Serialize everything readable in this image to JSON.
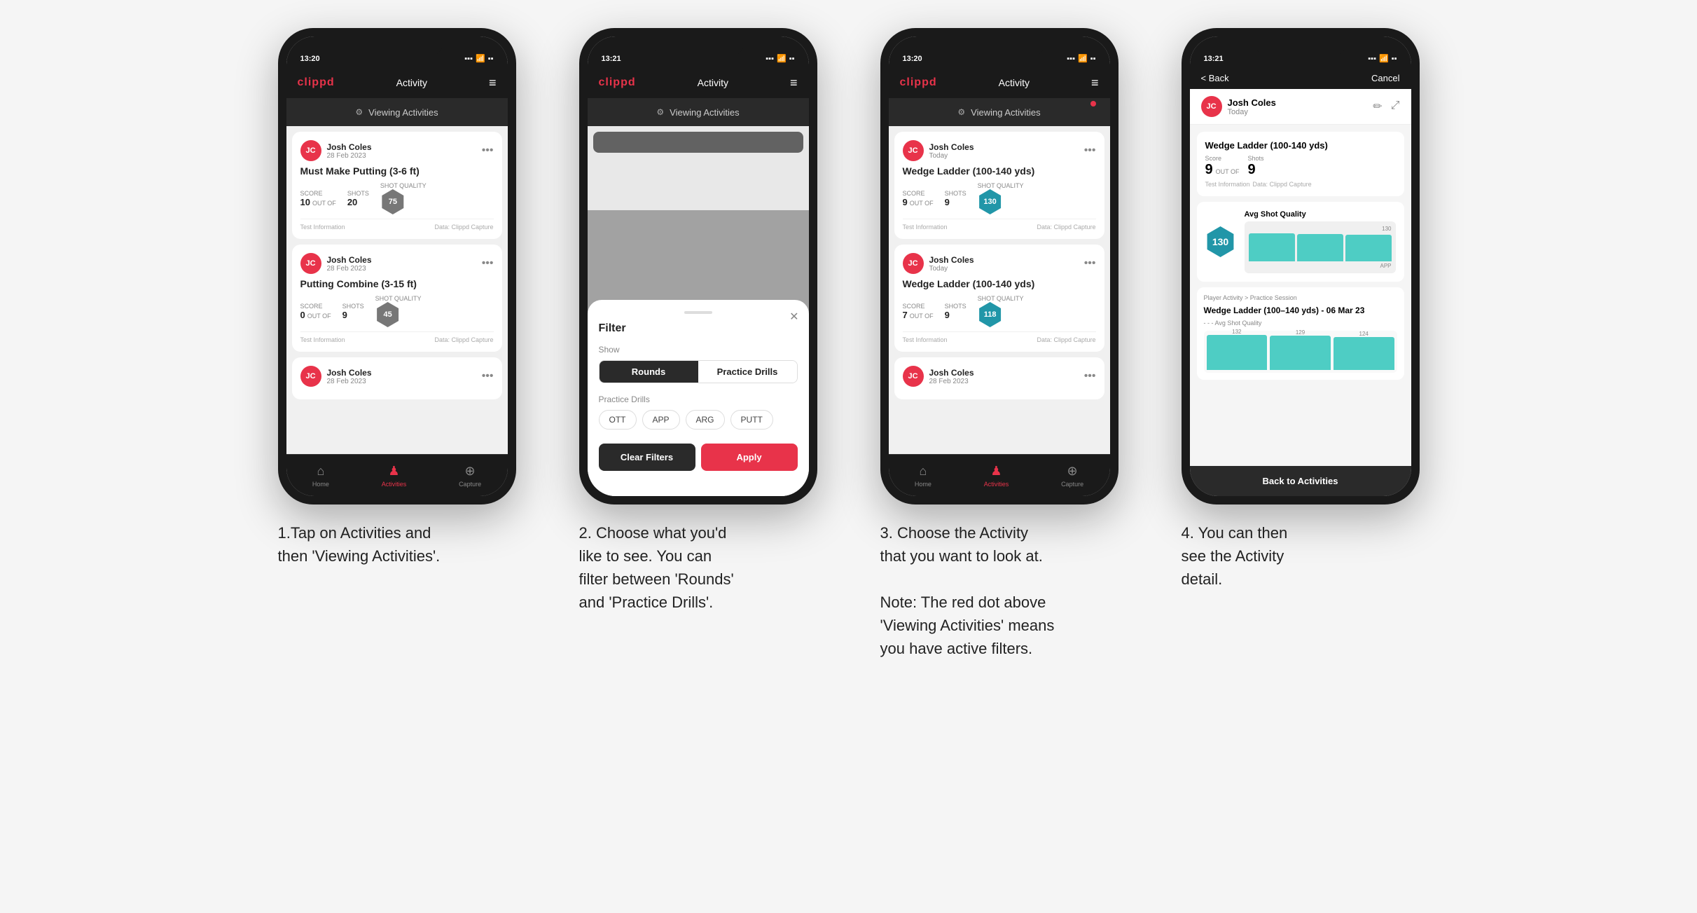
{
  "screens": [
    {
      "id": "screen1",
      "status_time": "13:20",
      "nav_title": "Activity",
      "viewing_activities": "Viewing Activities",
      "has_red_dot": false,
      "cards": [
        {
          "user_name": "Josh Coles",
          "user_date": "28 Feb 2023",
          "title": "Must Make Putting (3-6 ft)",
          "score_label": "Score",
          "shots_label": "Shots",
          "sq_label": "Shot Quality",
          "score": "10",
          "outof": "OUT OF",
          "shots": "20",
          "sq_value": "75",
          "info_left": "Test Information",
          "info_right": "Data: Clippd Capture"
        },
        {
          "user_name": "Josh Coles",
          "user_date": "28 Feb 2023",
          "title": "Putting Combine (3-15 ft)",
          "score_label": "Score",
          "shots_label": "Shots",
          "sq_label": "Shot Quality",
          "score": "0",
          "outof": "OUT OF",
          "shots": "9",
          "sq_value": "45",
          "info_left": "Test Information",
          "info_right": "Data: Clippd Capture"
        },
        {
          "user_name": "Josh Coles",
          "user_date": "28 Feb 2023",
          "title": "",
          "score": "",
          "shots": "",
          "sq_value": ""
        }
      ],
      "bottom_nav": [
        "Home",
        "Activities",
        "Capture"
      ]
    },
    {
      "id": "screen2",
      "status_time": "13:21",
      "nav_title": "Activity",
      "viewing_activities": "Viewing Activities",
      "has_red_dot": false,
      "filter": {
        "title": "Filter",
        "show_label": "Show",
        "rounds_label": "Rounds",
        "practice_drills_label": "Practice Drills",
        "practice_drills_section": "Practice Drills",
        "chips": [
          "OTT",
          "APP",
          "ARG",
          "PUTT"
        ],
        "clear_label": "Clear Filters",
        "apply_label": "Apply"
      }
    },
    {
      "id": "screen3",
      "status_time": "13:20",
      "nav_title": "Activity",
      "viewing_activities": "Viewing Activities",
      "has_red_dot": true,
      "cards": [
        {
          "user_name": "Josh Coles",
          "user_date": "Today",
          "title": "Wedge Ladder (100-140 yds)",
          "score": "9",
          "outof": "OUT OF",
          "shots": "9",
          "sq_value": "130",
          "info_left": "Test Information",
          "info_right": "Data: Clippd Capture"
        },
        {
          "user_name": "Josh Coles",
          "user_date": "Today",
          "title": "Wedge Ladder (100-140 yds)",
          "score": "7",
          "outof": "OUT OF",
          "shots": "9",
          "sq_value": "118",
          "info_left": "Test Information",
          "info_right": "Data: Clippd Capture"
        },
        {
          "user_name": "Josh Coles",
          "user_date": "28 Feb 2023",
          "title": "",
          "score": "",
          "shots": "",
          "sq_value": ""
        }
      ],
      "bottom_nav": [
        "Home",
        "Activities",
        "Capture"
      ]
    },
    {
      "id": "screen4",
      "status_time": "13:21",
      "back_label": "< Back",
      "cancel_label": "Cancel",
      "user_name": "Josh Coles",
      "user_date": "Today",
      "card_title": "Wedge Ladder (100-140 yds)",
      "score_label": "Score",
      "shots_label": "Shots",
      "score": "9",
      "outof": "OUT OF",
      "shots": "9",
      "sq_value": "130",
      "test_info": "Test Information",
      "data_source": "Data: Clippd Capture",
      "avg_sq_label": "Avg Shot Quality",
      "session_label": "Player Activity > Practice Session",
      "activity_title": "Wedge Ladder (100–140 yds) - 06 Mar 23",
      "avg_sq_sub": "- - - Avg Shot Quality",
      "chart_bars": [
        132,
        129,
        124
      ],
      "chart_labels": [
        "",
        "",
        ""
      ],
      "back_btn_label": "Back to Activities"
    }
  ],
  "captions": [
    "1.Tap on Activities and\nthen 'Viewing Activities'.",
    "2. Choose what you'd\nlike to see. You can\nfilter between 'Rounds'\nand 'Practice Drills'.",
    "3. Choose the Activity\nthat you want to look at.\n\nNote: The red dot above\n'Viewing Activities' means\nyou have active filters.",
    "4. You can then\nsee the Activity\ndetail."
  ]
}
